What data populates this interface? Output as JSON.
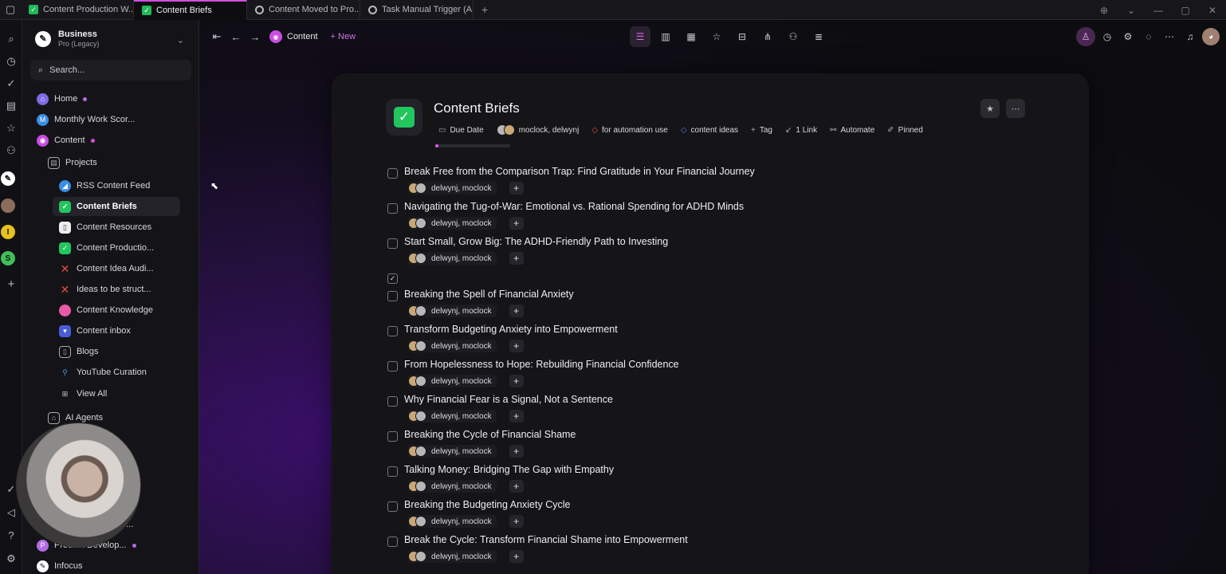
{
  "tabs": [
    {
      "label": "Content Production W...",
      "icon": "checkbox-icon",
      "active": false
    },
    {
      "label": "Content Briefs",
      "icon": "checkbox-icon",
      "active": true
    },
    {
      "label": "Content Moved to Pro...",
      "icon": "loading-icon",
      "active": false
    },
    {
      "label": "Task Manual Trigger (A...",
      "icon": "loading-icon",
      "active": false
    }
  ],
  "workspace": {
    "name": "Business",
    "plan": "Pro (Legacy)"
  },
  "search": {
    "placeholder": "Search..."
  },
  "sidebar": {
    "items": [
      {
        "label": "Home",
        "icon": "home-icon"
      },
      {
        "label": "Monthly Work Scor...",
        "icon": "m-icon"
      },
      {
        "label": "Content",
        "icon": "content-icon"
      },
      {
        "label": "Projects",
        "icon": "projects-icon"
      },
      {
        "label": "RSS Content Feed",
        "icon": "rss-icon"
      },
      {
        "label": "Content Briefs",
        "icon": "checkbox-icon"
      },
      {
        "label": "Content Resources",
        "icon": "page-icon"
      },
      {
        "label": "Content Productio...",
        "icon": "checkbox-icon"
      },
      {
        "label": "Content Idea Audi...",
        "icon": "x-icon"
      },
      {
        "label": "Ideas to be struct...",
        "icon": "x-icon"
      },
      {
        "label": "Content Knowledge",
        "icon": "brain-icon"
      },
      {
        "label": "Content inbox",
        "icon": "inbox-icon"
      },
      {
        "label": "Blogs",
        "icon": "page-icon"
      },
      {
        "label": "YouTube Curation",
        "icon": "pin-icon"
      },
      {
        "label": "View All",
        "icon": "grid-icon"
      },
      {
        "label": "AI Agents",
        "icon": "robot-icon"
      },
      {
        "label": "Product Develop...",
        "icon": "p-icon"
      },
      {
        "label": "Infocus",
        "icon": "infocus-icon"
      }
    ],
    "partial_label": "ge..."
  },
  "rail": {
    "workspaces": [
      "I",
      "S"
    ]
  },
  "breadcrumb": {
    "label": "Content",
    "new_label": "New"
  },
  "page": {
    "title": "Content Briefs",
    "props": {
      "due_date": "Due Date",
      "owners": "moclock, delwynj",
      "tag1": "for automation use",
      "tag2": "content ideas",
      "tag_add": "Tag",
      "link": "1 Link",
      "automate": "Automate",
      "pinned": "Pinned"
    },
    "progress": 0.04
  },
  "tasks": [
    {
      "title": "Break Free from the Comparison Trap: Find Gratitude in Your Financial Journey",
      "assignees": "delwynj, moclock",
      "checked": false
    },
    {
      "title": "Navigating the Tug-of-War: Emotional vs. Rational Spending for ADHD Minds",
      "assignees": "delwynj, moclock",
      "checked": false
    },
    {
      "title": "Start Small, Grow Big: The ADHD-Friendly Path to Investing",
      "assignees": "delwynj, moclock",
      "checked": false
    },
    {
      "title": "",
      "assignees": "",
      "checked": true
    },
    {
      "title": "Breaking the Spell of Financial Anxiety",
      "assignees": "delwynj, moclock",
      "checked": false
    },
    {
      "title": "Transform Budgeting Anxiety into Empowerment",
      "assignees": "delwynj, moclock",
      "checked": false
    },
    {
      "title": "From Hopelessness to Hope: Rebuilding Financial Confidence",
      "assignees": "delwynj, moclock",
      "checked": false
    },
    {
      "title": "Why Financial Fear is a Signal, Not a Sentence",
      "assignees": "delwynj, moclock",
      "checked": false
    },
    {
      "title": "Breaking the Cycle of Financial Shame",
      "assignees": "delwynj, moclock",
      "checked": false
    },
    {
      "title": "Talking Money: Bridging The Gap with Empathy",
      "assignees": "delwynj, moclock",
      "checked": false
    },
    {
      "title": "Breaking the Budgeting Anxiety Cycle",
      "assignees": "delwynj, moclock",
      "checked": false
    },
    {
      "title": "Break the Cycle: Transform Financial Shame into Empowerment",
      "assignees": "delwynj, moclock",
      "checked": false
    }
  ],
  "colors": {
    "accent": "#d24de0",
    "green": "#22c55e",
    "tag_red": "#e8493e",
    "tag_blue": "#5d76e6"
  }
}
